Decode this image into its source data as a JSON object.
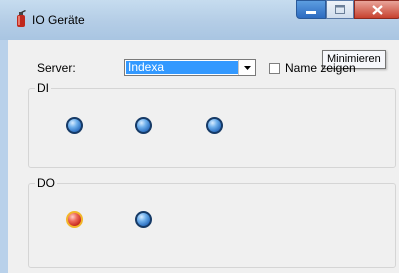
{
  "window": {
    "title": "IO Geräte",
    "icon": "fire-extinguisher-icon",
    "tooltip": "Minimieren"
  },
  "server": {
    "label": "Server:",
    "selected": "Indexa"
  },
  "show_name": {
    "label": "Name zeigen",
    "checked": false
  },
  "groups": {
    "di": {
      "title": "DI",
      "states": [
        "off",
        "off",
        "off"
      ]
    },
    "do": {
      "title": "DO",
      "states": [
        "on",
        "off"
      ]
    }
  },
  "colors": {
    "led_off": "#2c6fc0",
    "led_on": "#c6281c",
    "led_on_ring": "#f2b62a",
    "selection": "#3399ff"
  }
}
